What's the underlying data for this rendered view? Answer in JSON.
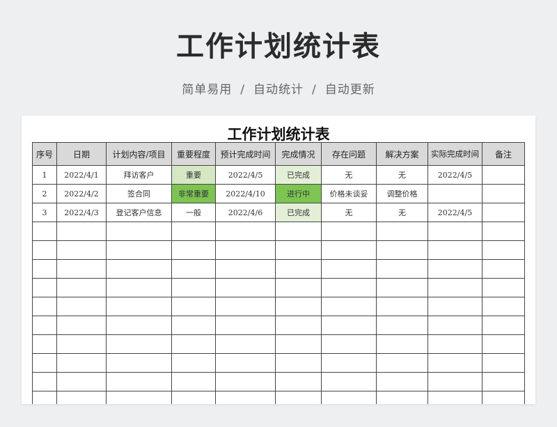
{
  "header": {
    "title": "工作计划统计表",
    "subtitle": [
      "简单易用",
      "自动统计",
      "自动更新"
    ],
    "separator": "/"
  },
  "sheet": {
    "title": "工作计划统计表",
    "columns": [
      "序号",
      "日期",
      "计划内容/项目",
      "重要程度",
      "预计完成时间",
      "完成情况",
      "存在问题",
      "解决方案",
      "实际完成时间",
      "备注"
    ],
    "rows": [
      {
        "no": "1",
        "date": "2022/4/1",
        "content": "拜访客户",
        "priority": "重要",
        "expected": "2022/4/5",
        "status": "已完成",
        "issue": "无",
        "solution": "无",
        "actual": "2022/4/5",
        "note": ""
      },
      {
        "no": "2",
        "date": "2022/4/2",
        "content": "签合同",
        "priority": "非常重要",
        "expected": "2022/4/10",
        "status": "进行中",
        "issue": "价格未谈妥",
        "solution": "调整价格",
        "actual": "",
        "note": ""
      },
      {
        "no": "3",
        "date": "2022/4/3",
        "content": "登记客户信息",
        "priority": "一般",
        "expected": "2022/4/6",
        "status": "已完成",
        "issue": "无",
        "solution": "无",
        "actual": "2022/4/5",
        "note": ""
      }
    ]
  },
  "colors": {
    "header_fill": "#d9d9d9",
    "priority_important": "#d6e7c3",
    "priority_urgent": "#7dc453",
    "status_done": "#e4efd8",
    "status_in_progress": "#7dc453"
  }
}
